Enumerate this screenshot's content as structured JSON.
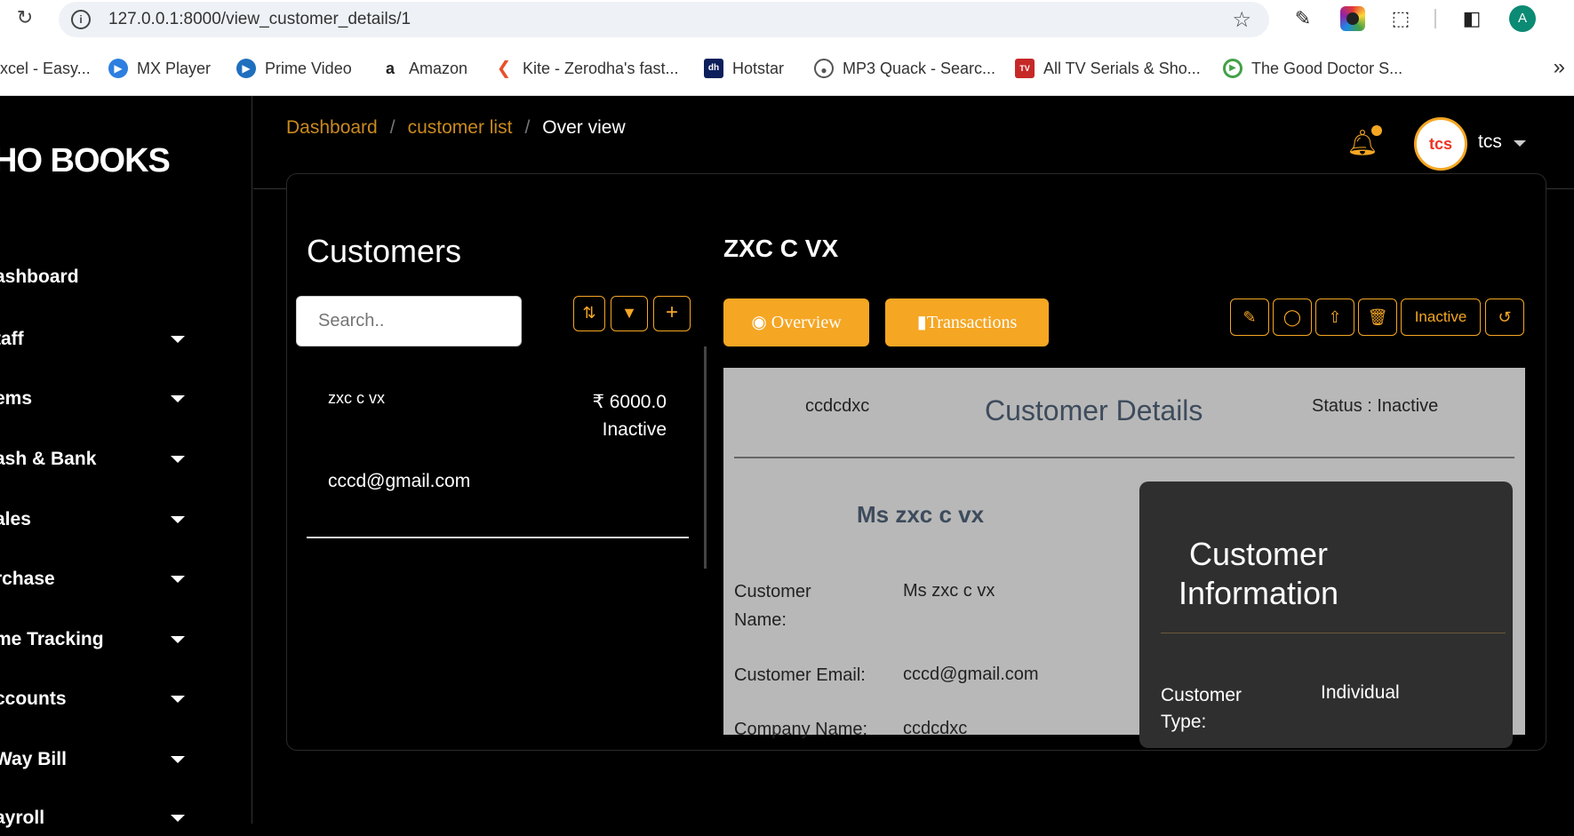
{
  "browser": {
    "url": "127.0.0.1:8000/view_customer_details/1",
    "profile_initial": "A",
    "bookmarks": [
      {
        "label": "xcel - Easy...",
        "icon": "excel-icon"
      },
      {
        "label": "MX Player",
        "icon": "play-icon"
      },
      {
        "label": "Prime Video",
        "icon": "play-icon"
      },
      {
        "label": "Amazon",
        "icon": "amazon-icon"
      },
      {
        "label": "Kite - Zerodha's fast...",
        "icon": "kite-icon"
      },
      {
        "label": "Hotstar",
        "icon": "hotstar-icon"
      },
      {
        "label": "MP3 Quack - Searc...",
        "icon": "duck-icon"
      },
      {
        "label": "All TV Serials & Sho...",
        "icon": "tv-icon"
      },
      {
        "label": "The Good Doctor S...",
        "icon": "play-icon"
      }
    ],
    "bookmarks_more": "»"
  },
  "sidebar": {
    "brand": "HO BOOKS",
    "items": [
      {
        "label": "ashboard",
        "has_caret": false
      },
      {
        "label": "taff",
        "has_caret": true
      },
      {
        "label": "ems",
        "has_caret": true
      },
      {
        "label": "ash & Bank",
        "has_caret": true
      },
      {
        "label": "ales",
        "has_caret": true
      },
      {
        "label": "rchase",
        "has_caret": true
      },
      {
        "label": "me Tracking",
        "has_caret": true
      },
      {
        "label": "ccounts",
        "has_caret": true
      },
      {
        "label": "Way Bill",
        "has_caret": true
      },
      {
        "label": "ayroll",
        "has_caret": true
      }
    ]
  },
  "topbar": {
    "username": "tcs",
    "avatar_text": "tcs"
  },
  "breadcrumb": {
    "items": [
      "Dashboard",
      "customer list"
    ],
    "separator": "/",
    "current": "Over view"
  },
  "customers": {
    "title": "Customers",
    "search_placeholder": "Search..",
    "list": [
      {
        "name": "zxc c vx",
        "amount": "₹ 6000.0",
        "status": "Inactive",
        "email": "cccd@gmail.com"
      }
    ]
  },
  "detail": {
    "title": "ZXC C VX",
    "tabs": {
      "overview": "Overview",
      "transactions": "Transactions"
    },
    "inactive_button": "Inactive",
    "card": {
      "company": "ccdcdxc",
      "title": "Customer Details",
      "status": "Status : Inactive",
      "display_name": "Ms  zxc  c vx",
      "fields": [
        {
          "label": "Customer Name:",
          "value": "Ms  zxc  c vx"
        },
        {
          "label": "Customer Email:",
          "value": "cccd@gmail.com"
        },
        {
          "label": "Company Name:",
          "value": "ccdcdxc"
        }
      ],
      "info": {
        "title": "Customer Information",
        "type_label": "Customer Type:",
        "type_value": "Individual"
      }
    }
  },
  "colors": {
    "accent": "#f5a623",
    "breadcrumb_link": "#c98a1e",
    "card_bg": "#b8b8b8"
  }
}
